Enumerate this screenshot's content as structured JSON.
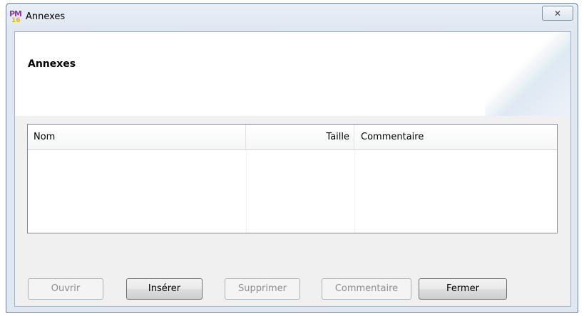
{
  "window": {
    "title": "Annexes",
    "logo_text": "PM",
    "logo_sub": "16",
    "close_glyph": "✕"
  },
  "header": {
    "title": "Annexes"
  },
  "table": {
    "columns": [
      "Nom",
      "Taille",
      "Commentaire"
    ],
    "rows": []
  },
  "buttons": {
    "open": "Ouvrir",
    "insert": "Insérer",
    "delete": "Supprimer",
    "comment": "Commentaire",
    "close": "Fermer"
  },
  "colors": {
    "title_bar": "#dfe7f1",
    "client_bg": "#f0f0f0",
    "disabled_text": "#8d8d8d"
  }
}
